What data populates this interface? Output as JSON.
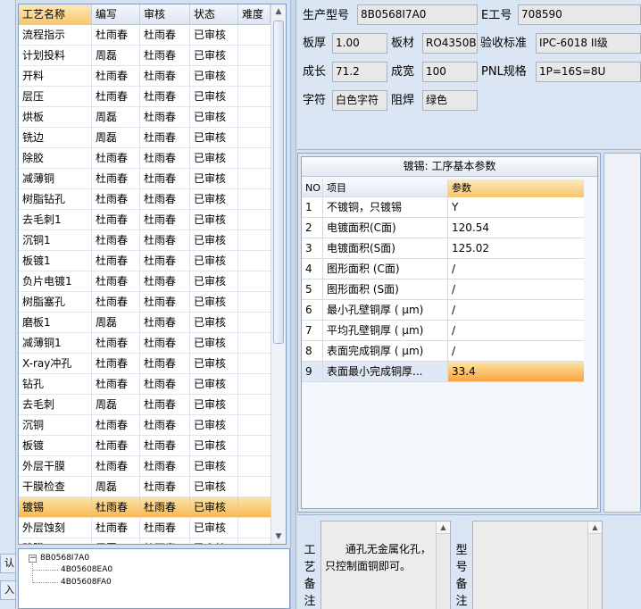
{
  "left_strip": {
    "btn1": "认",
    "btn2": "入"
  },
  "process_grid": {
    "headers": [
      "工艺名称",
      "编写",
      "审核",
      "状态",
      "难度"
    ],
    "rows": [
      [
        "流程指示",
        "杜雨春",
        "杜雨春",
        "已审核",
        ""
      ],
      [
        "计划投料",
        "周磊",
        "杜雨春",
        "已审核",
        ""
      ],
      [
        "开料",
        "杜雨春",
        "杜雨春",
        "已审核",
        ""
      ],
      [
        "层压",
        "杜雨春",
        "杜雨春",
        "已审核",
        ""
      ],
      [
        "烘板",
        "周磊",
        "杜雨春",
        "已审核",
        ""
      ],
      [
        "铣边",
        "周磊",
        "杜雨春",
        "已审核",
        ""
      ],
      [
        "除胶",
        "杜雨春",
        "杜雨春",
        "已审核",
        ""
      ],
      [
        "减薄铜",
        "杜雨春",
        "杜雨春",
        "已审核",
        ""
      ],
      [
        "树脂钻孔",
        "杜雨春",
        "杜雨春",
        "已审核",
        ""
      ],
      [
        "去毛刺1",
        "杜雨春",
        "杜雨春",
        "已审核",
        ""
      ],
      [
        "沉铜1",
        "杜雨春",
        "杜雨春",
        "已审核",
        ""
      ],
      [
        "板镀1",
        "杜雨春",
        "杜雨春",
        "已审核",
        ""
      ],
      [
        "负片电镀1",
        "杜雨春",
        "杜雨春",
        "已审核",
        ""
      ],
      [
        "树脂塞孔",
        "杜雨春",
        "杜雨春",
        "已审核",
        ""
      ],
      [
        "磨板1",
        "周磊",
        "杜雨春",
        "已审核",
        ""
      ],
      [
        "减薄铜1",
        "杜雨春",
        "杜雨春",
        "已审核",
        ""
      ],
      [
        "X-ray冲孔",
        "杜雨春",
        "杜雨春",
        "已审核",
        ""
      ],
      [
        "钻孔",
        "杜雨春",
        "杜雨春",
        "已审核",
        ""
      ],
      [
        "去毛刺",
        "周磊",
        "杜雨春",
        "已审核",
        ""
      ],
      [
        "沉铜",
        "杜雨春",
        "杜雨春",
        "已审核",
        ""
      ],
      [
        "板镀",
        "杜雨春",
        "杜雨春",
        "已审核",
        ""
      ],
      [
        "外层干膜",
        "杜雨春",
        "杜雨春",
        "已审核",
        ""
      ],
      [
        "干膜检查",
        "周磊",
        "杜雨春",
        "已审核",
        ""
      ],
      [
        "镀锡",
        "杜雨春",
        "杜雨春",
        "已审核",
        ""
      ],
      [
        "外层蚀刻",
        "杜雨春",
        "杜雨春",
        "已审核",
        ""
      ],
      [
        "残膜",
        "周磊",
        "杜雨春",
        "已审核",
        ""
      ]
    ],
    "selected_index": 23
  },
  "tree": {
    "root": "8B0568I7A0",
    "children": [
      "4B05608EA0",
      "4B05608FA0"
    ]
  },
  "info": {
    "model_label": "生产型号",
    "model_value": "8B0568I7A0",
    "e_label": "E工号",
    "e_value": "708590",
    "thick_label": "板厚",
    "thick_value": "1.00",
    "material_label": "板材",
    "material_value": "RO4350B",
    "standard_label": "验收标准",
    "standard_value": "IPC-6018 II级",
    "growth_label": "成长",
    "growth_value": "71.2",
    "width_label": "成宽",
    "width_value": "100",
    "pnl_label": "PNL规格",
    "pnl_value": "1P=16S=8U",
    "char_label": "字符",
    "char_value": "白色字符",
    "mask_label": "阻焊",
    "mask_value": "绿色"
  },
  "params": {
    "title": "镀锡: 工序基本参数",
    "headers": [
      "NO",
      "项目",
      "参数"
    ],
    "rows": [
      [
        "1",
        "不镀铜，只镀锡",
        "Y"
      ],
      [
        "2",
        "电镀面积(C面)",
        "120.54"
      ],
      [
        "3",
        "电镀面积(S面)",
        "125.02"
      ],
      [
        "4",
        "图形面积 (C面)",
        "/"
      ],
      [
        "5",
        "图形面积 (S面)",
        "/"
      ],
      [
        "6",
        "最小孔壁铜厚 ( μm)",
        "/"
      ],
      [
        "7",
        "平均孔壁铜厚 ( μm)",
        "/"
      ],
      [
        "8",
        "表面完成铜厚 ( μm)",
        "/"
      ],
      [
        "9",
        "表面最小完成铜厚...",
        "33.4"
      ]
    ],
    "selected_index": 8
  },
  "remarks": {
    "process_label": [
      "工",
      "艺",
      "备",
      "注"
    ],
    "process_text": "通孔无金属化孔，\n只控制面铜即可。",
    "model_label": [
      "型",
      "号",
      "备",
      "注"
    ],
    "model_text": ""
  }
}
